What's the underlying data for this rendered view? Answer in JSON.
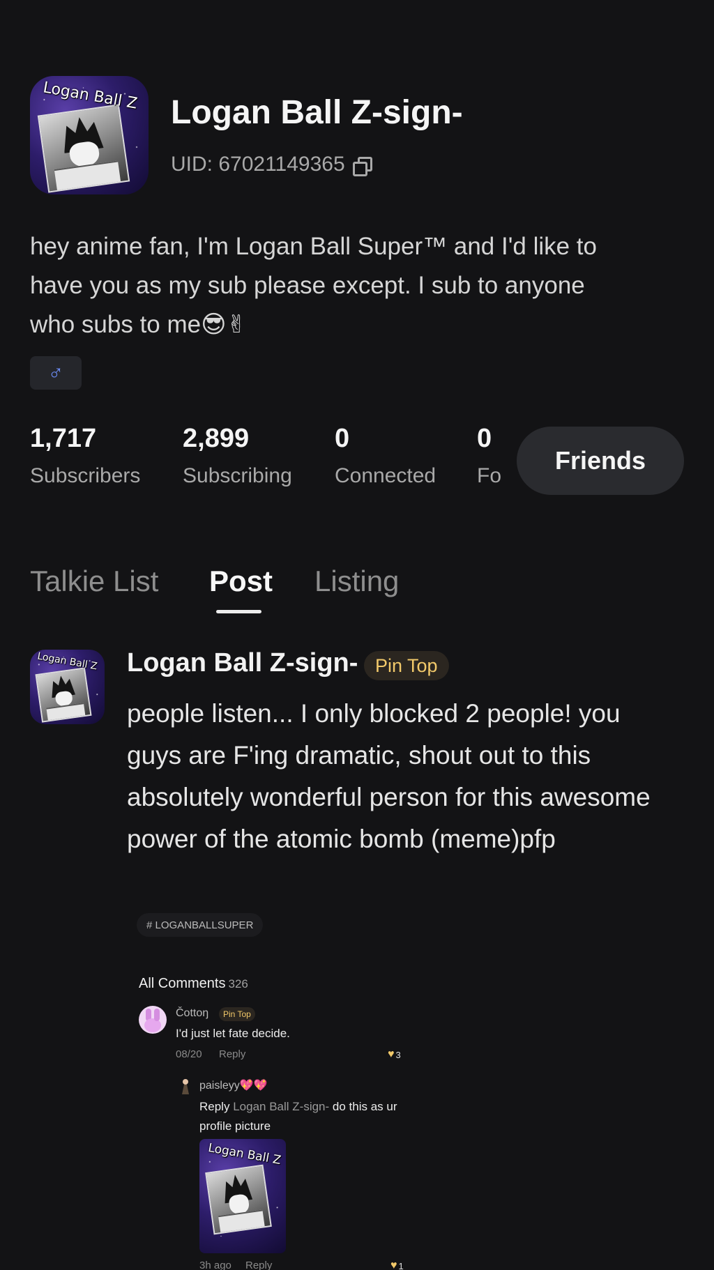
{
  "profile": {
    "avatar_logo_text": "Logan Ball Z",
    "username": "Logan Ball Z-sign-",
    "uid_label": "UID: 67021149365",
    "bio": "hey anime fan, I'm Logan Ball Super™ and I'd like to have you as my sub please except. I sub to anyone who subs to me😎✌",
    "gender_symbol": "♂",
    "stats": [
      {
        "value": "1,717",
        "label": "Subscribers"
      },
      {
        "value": "2,899",
        "label": "Subscribing"
      },
      {
        "value": "0",
        "label": "Connected"
      },
      {
        "value": "0",
        "label": "Fo"
      }
    ],
    "friends_label": "Friends"
  },
  "tabs": [
    {
      "label": "Talkie List",
      "active": false
    },
    {
      "label": "Post",
      "active": true
    },
    {
      "label": "Listing",
      "active": false
    }
  ],
  "post": {
    "author": "Logan Ball Z-sign-",
    "pin_label": "Pin Top",
    "text": "people listen... I only blocked 2 people! you guys are F'ing dramatic, shout out to this absolutely wonderful person for this awesome power of the atomic bomb (meme)pfp",
    "hashtag": "# LOGANBALLSUPER"
  },
  "comments": {
    "title": "All Comments",
    "count": "326",
    "top": {
      "author": "Čottoŋ",
      "pin_label": "Pin Top",
      "text": "I'd just let fate decide.",
      "date": "08/20",
      "reply_label": "Reply",
      "likes": "3"
    },
    "reply": {
      "author": "paisleyy💖💖",
      "prefix": "Reply",
      "mention": "Logan Ball Z-sign-",
      "text": "do this as ur profile picture",
      "image_logo_text": "Logan Ball Z",
      "date": "3h ago",
      "reply_label": "Reply",
      "likes": "1"
    }
  },
  "colors": {
    "background": "#131315",
    "pin_accent": "#F2C96A",
    "gender_icon": "#6C8CF5"
  }
}
